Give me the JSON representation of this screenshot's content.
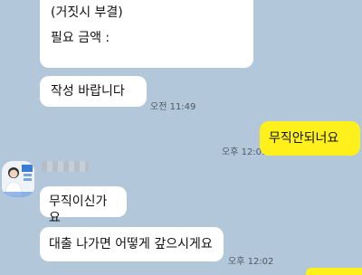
{
  "chat": {
    "messages": {
      "top_line1": "(거짓시 부결)",
      "top_line2": "필요 금액 :",
      "request": "작성 바랍니다",
      "request_time": "오전 11:49",
      "outgoing": "무직안되너요",
      "outgoing_time": "오후 12:01",
      "jobless": "무직이신가요",
      "loan": "대출 나가면 어떻게 갚으시게요",
      "loan_time": "오후 12:02"
    }
  },
  "colors": {
    "background": "#b2c7d9",
    "incoming_bubble": "#ffffff",
    "outgoing_bubble": "#fef01b"
  }
}
